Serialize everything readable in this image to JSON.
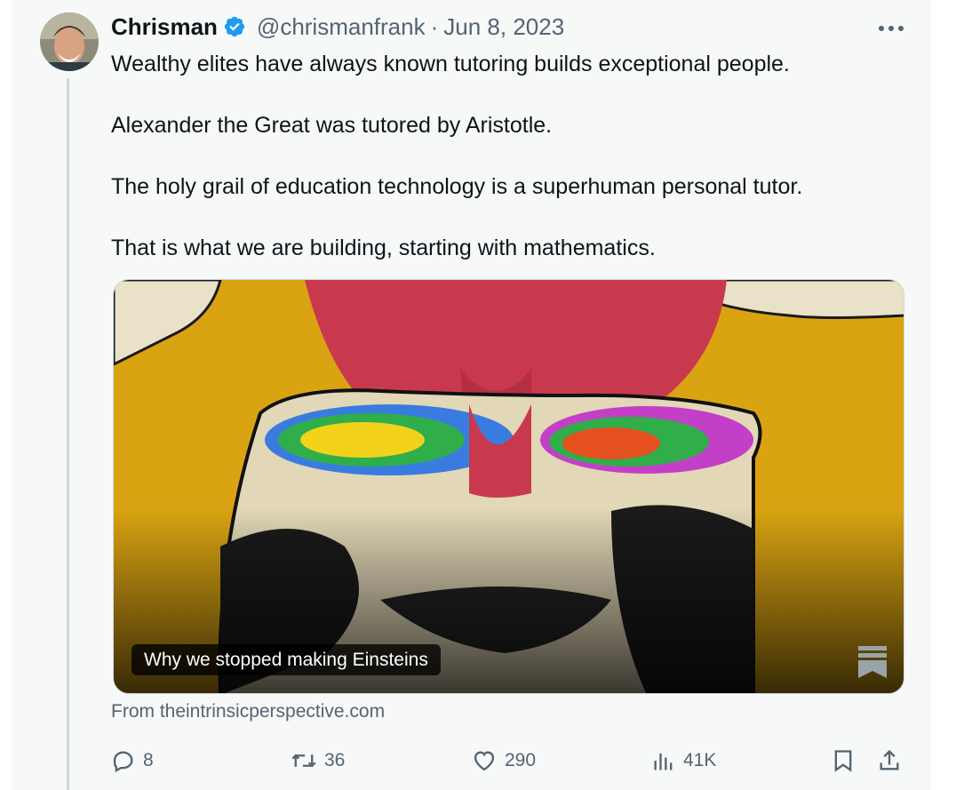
{
  "tweet": {
    "author_name": "Chrisman",
    "handle": "@chrismanfrank",
    "separator": "·",
    "date": "Jun 8, 2023",
    "more_icon": "more-horizontal-icon",
    "text": [
      "Wealthy elites have always known tutoring builds exceptional people.",
      "Alexander the Great was tutored by Aristotle.",
      "The holy grail of education technology is a superhuman personal tutor.",
      "That is what we are building, starting with mathematics."
    ]
  },
  "card": {
    "title": "Why we stopped making Einsteins",
    "source": "From theintrinsicperspective.com",
    "mark_icon": "bookmark-banner-icon"
  },
  "actions": {
    "reply_count": "8",
    "retweet_count": "36",
    "like_count": "290",
    "views_count": "41K"
  },
  "colors": {
    "verified": "#1d9bf0",
    "muted": "#536471",
    "thread_line": "#cfd9de",
    "card_bg": "#d9a312"
  }
}
